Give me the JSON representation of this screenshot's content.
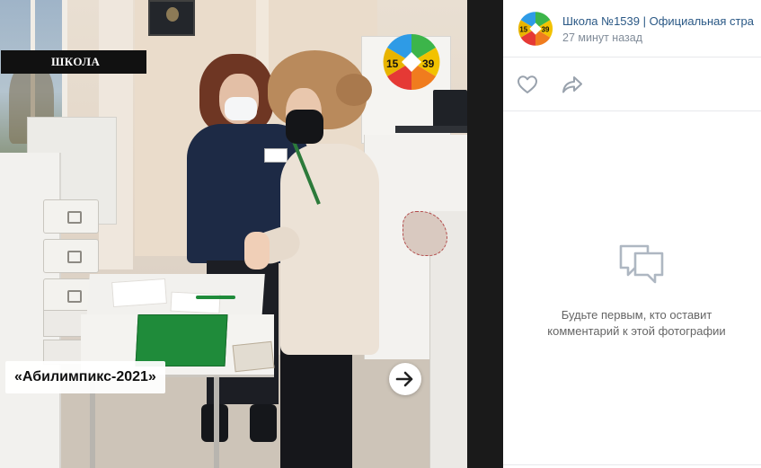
{
  "photo": {
    "school_label": "ШКОЛА",
    "event_label": "«Абилимпикс-2021»",
    "logo": {
      "left_number": "15",
      "right_number": "39"
    },
    "next_icon": "arrow-right-icon"
  },
  "post": {
    "group_name": "Школа №1539 | Официальная стра",
    "time": "27 минут назад",
    "avatar": {
      "left_number": "15",
      "right_number": "39"
    },
    "actions": {
      "like_icon": "heart-outline-icon",
      "share_icon": "share-arrow-icon"
    },
    "comments_empty": {
      "icon": "speech-bubbles-icon",
      "line1": "Будьте первым, кто оставит",
      "line2": "комментарий к этой фотографии"
    }
  },
  "colors": {
    "link": "#2a5885",
    "meta": "#818c99",
    "icon": "#99a2ad",
    "logo_segments": [
      "#2e9be6",
      "#3cb54a",
      "#f2c200",
      "#f07c1e",
      "#e53935",
      "#e8477e"
    ]
  }
}
